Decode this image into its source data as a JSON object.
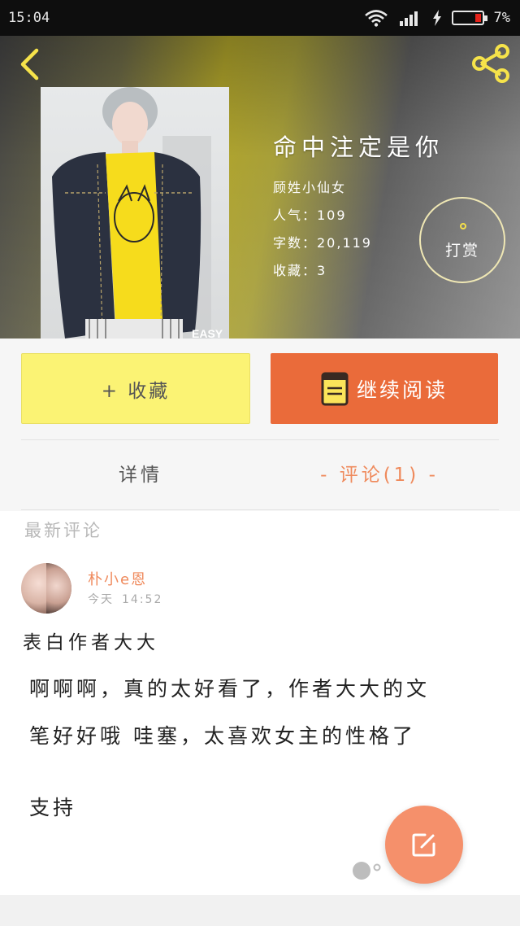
{
  "status_bar": {
    "time": "15:04",
    "battery": "7%"
  },
  "header": {
    "back_icon": "chevron-left-icon",
    "share_icon": "share-icon"
  },
  "book": {
    "title": "命中注定是你",
    "author": "顾姓小仙女",
    "popularity": "人气：109",
    "word_count": "字数：20,119",
    "favorites": "收藏：3",
    "cover_text": "EASY"
  },
  "reward": {
    "label": "打赏"
  },
  "actions": {
    "collect_label": "+ 收藏",
    "continue_label": "继续阅读"
  },
  "tabs": {
    "details": "详情",
    "comments": "- 评论(1) -"
  },
  "comments": {
    "section_label": "最新评论",
    "items": [
      {
        "username": "朴小e恩",
        "date": "今天",
        "time": "14:52",
        "title": "表白作者大大",
        "body_line1": "啊啊啊，真的太好看了，作者大大的文",
        "body_line2": "笔好好哦 哇塞，太喜欢女主的性格了",
        "body_line3": "支持"
      }
    ]
  },
  "colors": {
    "accent_orange": "#ea6b3a",
    "collect_yellow": "#fbf374",
    "tab_active": "#ef8a5c",
    "fab": "#f5906b"
  }
}
